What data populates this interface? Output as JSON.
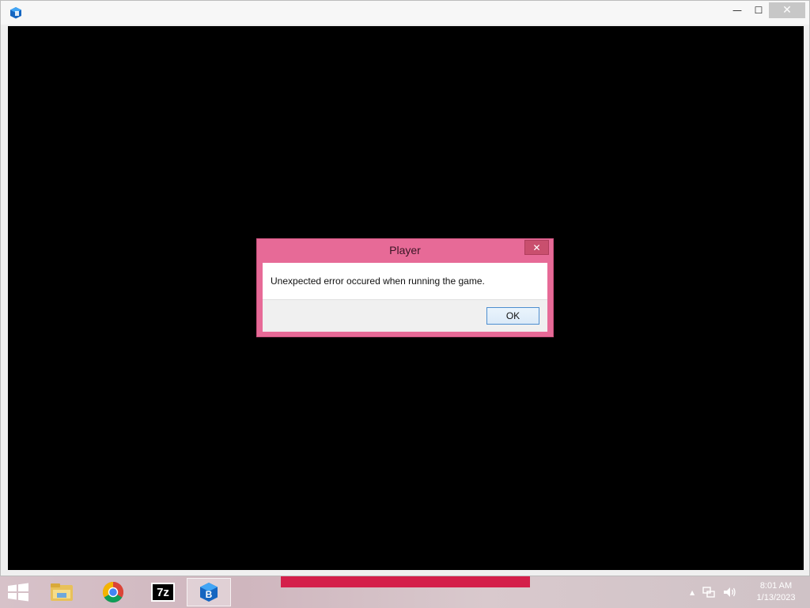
{
  "window": {
    "app_icon": "blue-cube-icon",
    "controls": {
      "minimize": "—",
      "maximize": "☐",
      "close": "✕"
    }
  },
  "dialog": {
    "title": "Player",
    "message": "Unexpected error occured when running the game.",
    "ok_label": "OK",
    "close_glyph": "✕"
  },
  "taskbar": {
    "pinned": [
      {
        "name": "file-explorer-icon"
      },
      {
        "name": "chrome-icon"
      },
      {
        "name": "7zip-icon",
        "label": "7z"
      },
      {
        "name": "app-cube-icon"
      }
    ],
    "tray": {
      "show_hidden": "▲",
      "time": "8:01 AM",
      "date": "1/13/2023"
    }
  },
  "colors": {
    "dialog_frame": "#e76a97",
    "dialog_close": "#c94f6e",
    "taskbar_accent": "#d41f4a"
  }
}
